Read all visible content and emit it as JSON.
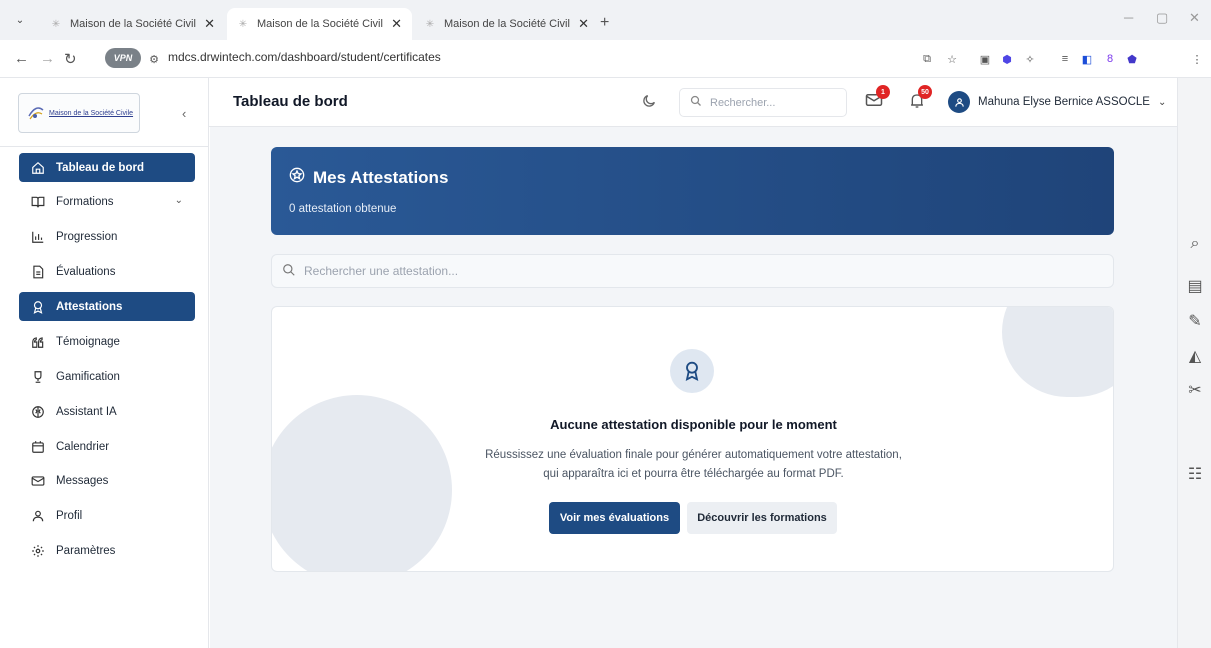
{
  "browser": {
    "tabs": [
      {
        "title": "Maison de la Société Civile - Pl"
      },
      {
        "title": "Maison de la Société Civile - Pl"
      },
      {
        "title": "Maison de la Société Civile - Pl"
      }
    ],
    "new_tab": "+",
    "vpn_label": "VPN",
    "url": "mdcs.drwintech.com/dashboard/student/certificates"
  },
  "sidebar": {
    "logo_text": "Maison de la Société Civile",
    "items": [
      {
        "label": "Tableau de bord",
        "icon": "home-icon",
        "active": true
      },
      {
        "label": "Formations",
        "icon": "book-icon",
        "active": false
      },
      {
        "label": "Progression",
        "icon": "bar-chart-icon",
        "active": false
      },
      {
        "label": "Évaluations",
        "icon": "file-text-icon",
        "active": false
      },
      {
        "label": "Attestations",
        "icon": "award-icon",
        "active": true
      },
      {
        "label": "Témoignage",
        "icon": "quote-icon",
        "active": false
      },
      {
        "label": "Gamification",
        "icon": "trophy-icon",
        "active": false
      },
      {
        "label": "Assistant IA",
        "icon": "brain-icon",
        "active": false
      },
      {
        "label": "Calendrier",
        "icon": "calendar-icon",
        "active": false
      },
      {
        "label": "Messages",
        "icon": "mail-icon",
        "active": false
      },
      {
        "label": "Profil",
        "icon": "user-icon",
        "active": false
      },
      {
        "label": "Paramètres",
        "icon": "settings-icon",
        "active": false
      }
    ]
  },
  "header": {
    "title": "Tableau de bord",
    "search_placeholder": "Rechercher...",
    "mail_count": "1",
    "notification_count": "50",
    "user_name": "Mahuna Elyse Bernice ASSOCLE"
  },
  "hero": {
    "title": "Mes Attestations",
    "subtitle": "0 attestation obtenue"
  },
  "search": {
    "placeholder": "Rechercher une attestation..."
  },
  "empty_state": {
    "title": "Aucune attestation disponible pour le moment",
    "text": "Réussissez une évaluation finale pour générer automatiquement votre attestation, qui apparaîtra ici et pourra être téléchargée au format PDF.",
    "primary_button": "Voir mes évaluations",
    "secondary_button": "Découvrir les formations"
  },
  "colors": {
    "primary": "#1e4b83",
    "badge": "#e02424",
    "background": "#f3f5f8"
  }
}
